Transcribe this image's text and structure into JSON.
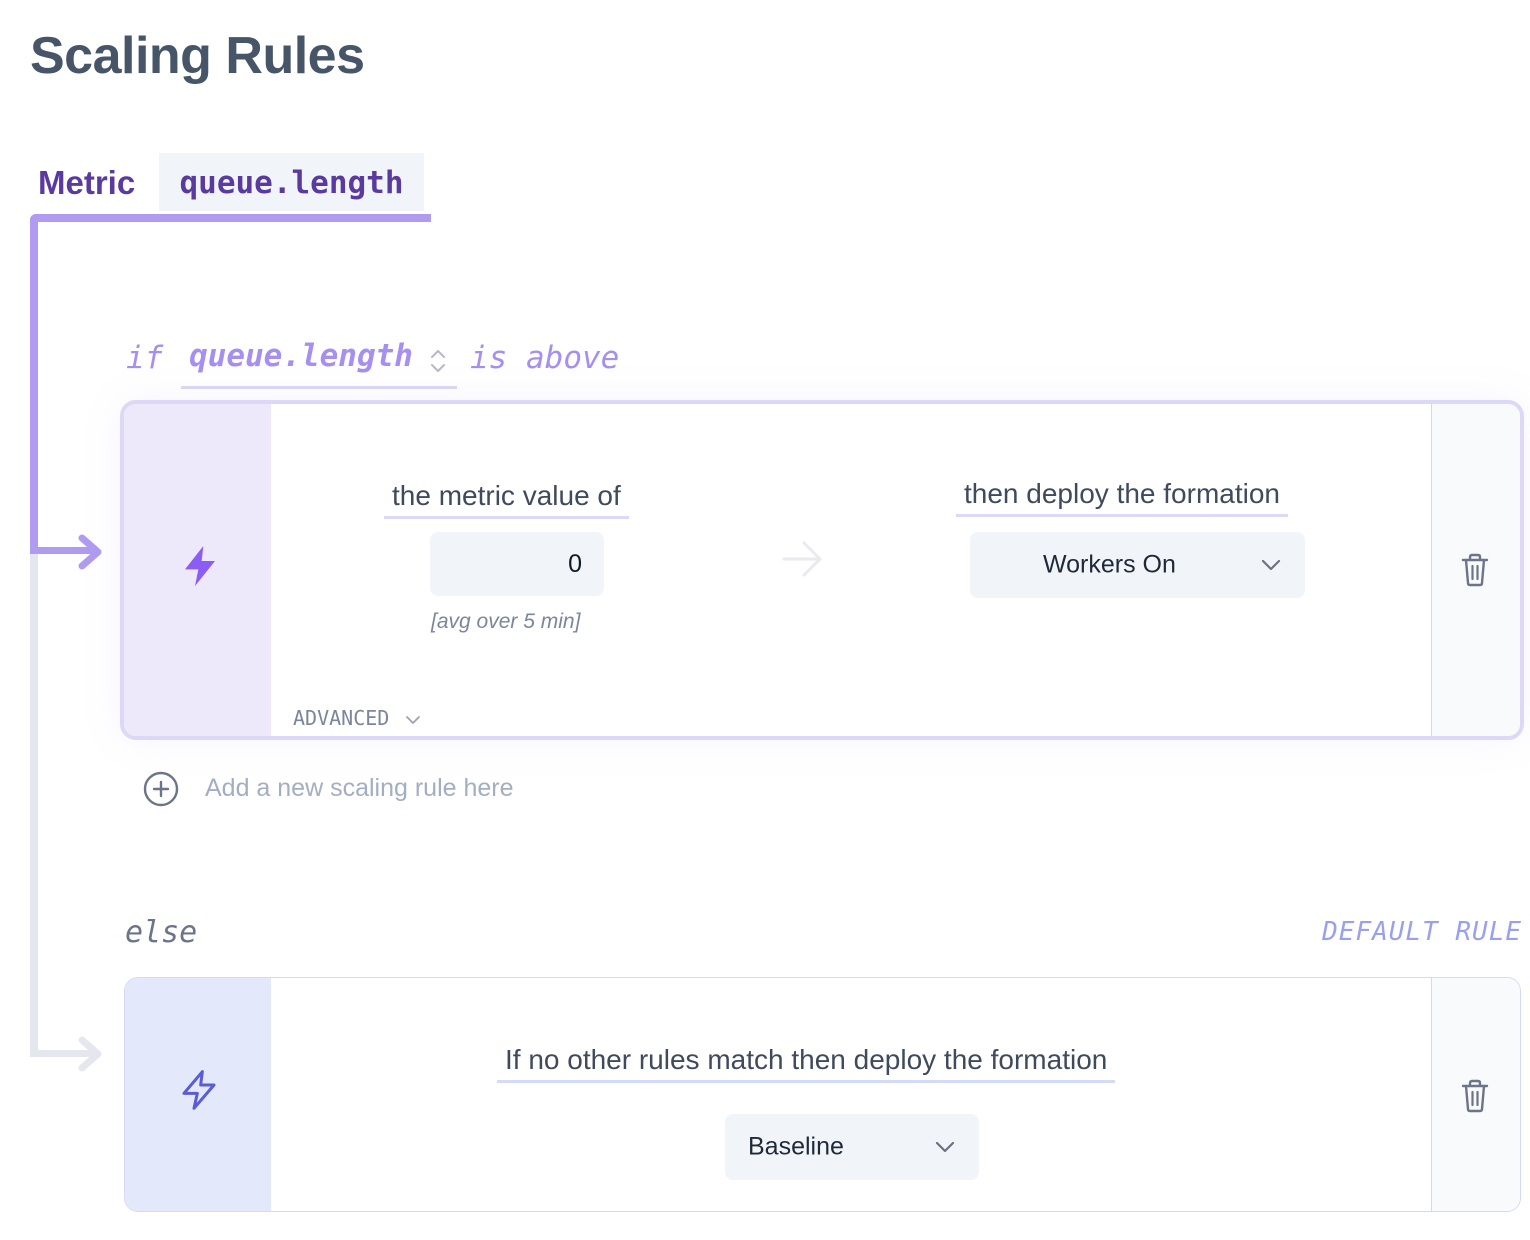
{
  "page": {
    "title": "Scaling Rules"
  },
  "metric": {
    "label": "Metric",
    "value": "queue.length"
  },
  "condition": {
    "if_keyword": "if",
    "metric_selected": "queue.length",
    "comparator": "is above"
  },
  "rule": {
    "threshold_label": "the metric value of",
    "threshold_value": "0",
    "threshold_hint": "[avg over 5 min]",
    "action_label": "then deploy the formation",
    "formation_selected": "Workers On",
    "advanced_label": "ADVANCED",
    "icons": {
      "side": "lightning-filled-icon",
      "arrow": "arrow-right-icon",
      "delete": "trash-icon"
    }
  },
  "add_rule": {
    "label": "Add a new scaling rule here",
    "icon": "plus-circle-icon"
  },
  "else_block": {
    "else_keyword": "else",
    "badge": "DEFAULT RULE",
    "label": "If no other rules match then deploy the formation",
    "formation_selected": "Baseline",
    "icons": {
      "side": "lightning-outline-icon",
      "delete": "trash-icon"
    }
  },
  "colors": {
    "accent_purple": "#5b3aa0",
    "connector_active": "#b09bf0",
    "connector_inactive": "#e5e7ee",
    "lightning_active": "#8b5cf6",
    "lightning_default": "#5b5bd6",
    "default_badge": "#9aa0f0"
  }
}
